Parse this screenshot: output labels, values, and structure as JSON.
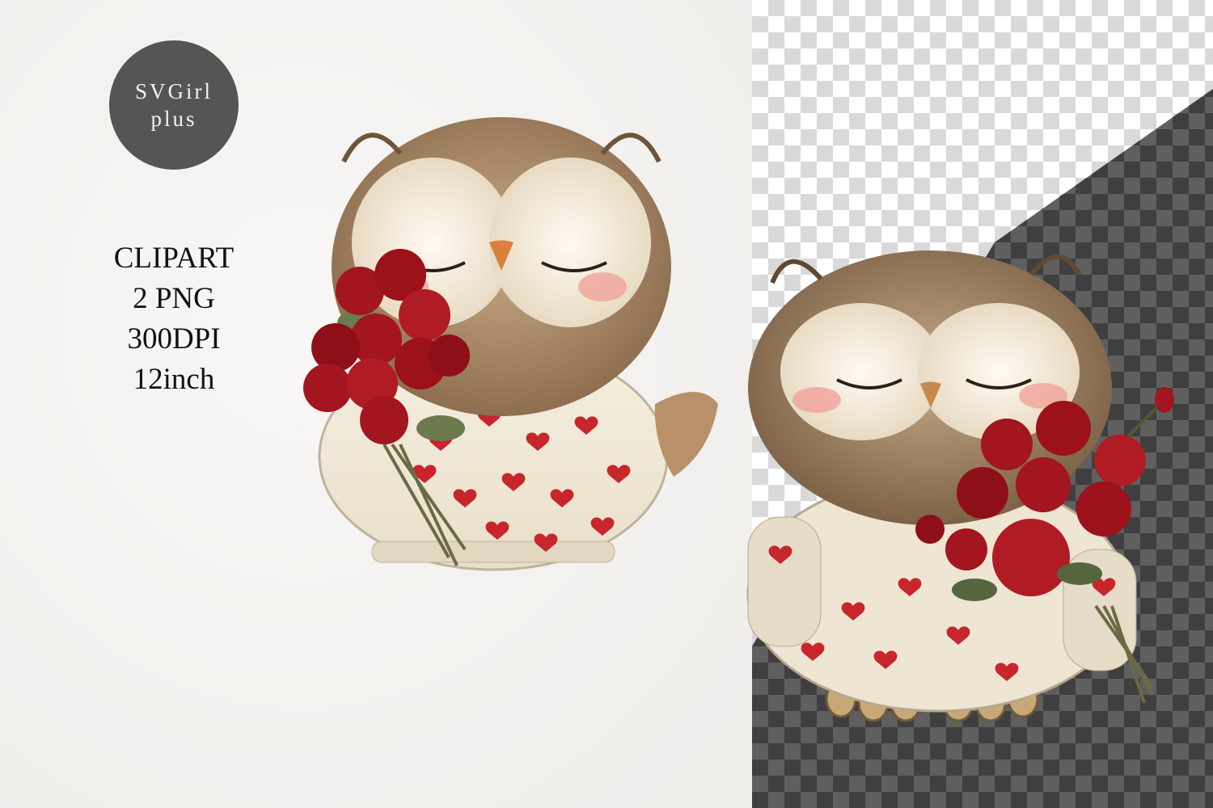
{
  "logo": {
    "line1": "SVGirl",
    "line2": "plus",
    "color": "#555555"
  },
  "specs": {
    "line1": "CLIPART",
    "line2": "2 PNG",
    "line3": "300DPI",
    "line4": "12inch"
  },
  "illustrations": [
    {
      "name": "owl-with-roses-left",
      "subject": "owl in heart sweater holding red roses"
    },
    {
      "name": "owl-with-roses-right",
      "subject": "owl in heart sweater holding red roses"
    }
  ],
  "colors": {
    "rose": "#a3151f",
    "sweater": "#f1e9d9",
    "feather": "#9c7d5c",
    "heart": "#c8252c"
  }
}
